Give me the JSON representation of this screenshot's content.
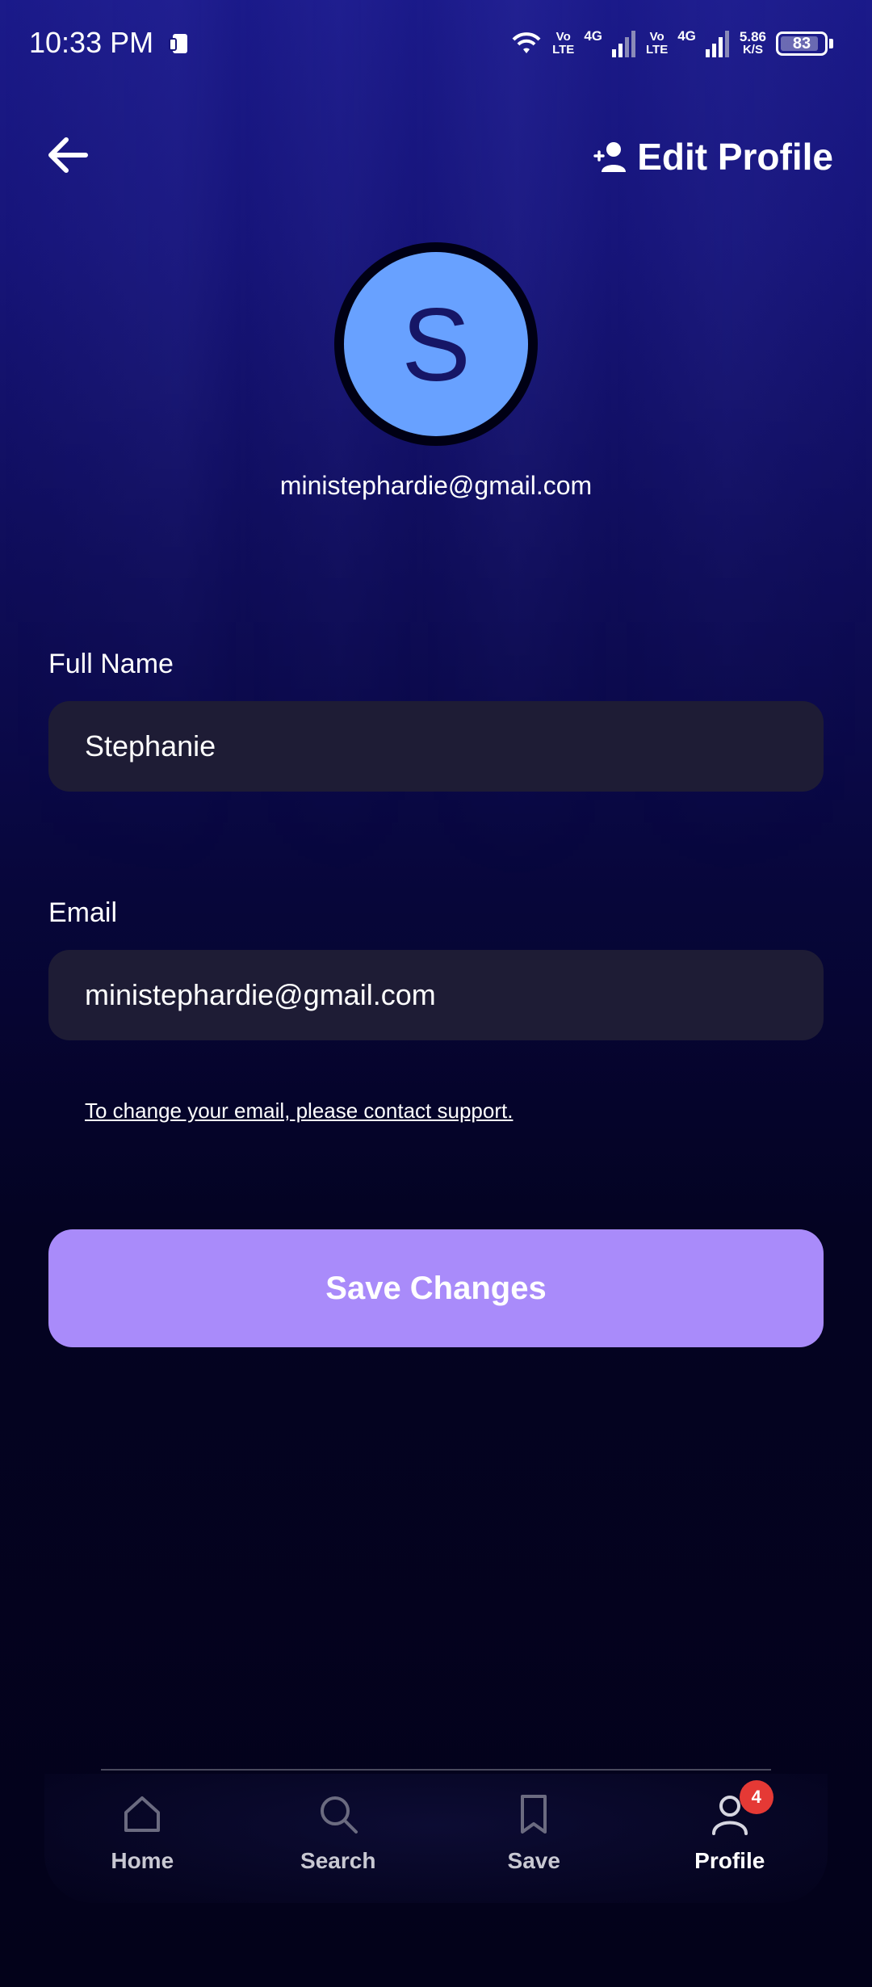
{
  "status_bar": {
    "time": "10:33 PM",
    "network_1_top": "Vo",
    "network_1_bottom": "LTE",
    "network_1_type": "4G",
    "network_2_top": "Vo",
    "network_2_bottom": "LTE",
    "network_2_type": "4G",
    "speed_value": "5.86",
    "speed_unit": "K/S",
    "battery": "83"
  },
  "header": {
    "title": "Edit Profile",
    "back_icon": "arrow-left-icon",
    "title_icon": "add-person-icon"
  },
  "profile": {
    "avatar_letter": "S",
    "email": "ministephardie@gmail.com",
    "avatar_color": "#68a1ff"
  },
  "form": {
    "full_name_label": "Full Name",
    "full_name_value": "Stephanie",
    "email_label": "Email",
    "email_value": "ministephardie@gmail.com",
    "support_text": "To change your email, please contact support.",
    "save_label": "Save Changes",
    "save_color": "#a98bfa"
  },
  "nav": {
    "items": [
      {
        "label": "Home",
        "icon": "home-icon"
      },
      {
        "label": "Search",
        "icon": "search-icon"
      },
      {
        "label": "Save",
        "icon": "bookmark-icon"
      },
      {
        "label": "Profile",
        "icon": "user-icon",
        "badge": "4",
        "active": true
      }
    ]
  }
}
